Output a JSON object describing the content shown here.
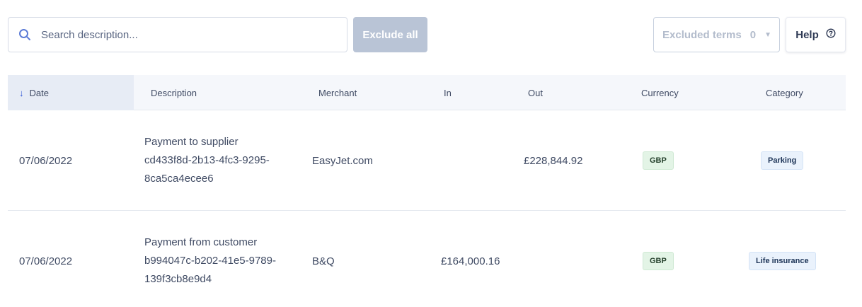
{
  "toolbar": {
    "search_placeholder": "Search description...",
    "exclude_all_label": "Exclude all",
    "excluded_terms_label": "Excluded terms",
    "excluded_terms_count": "0",
    "help_label": "Help"
  },
  "table": {
    "headers": {
      "date": "Date",
      "description": "Description",
      "merchant": "Merchant",
      "in": "In",
      "out": "Out",
      "currency": "Currency",
      "category": "Category"
    },
    "sort": {
      "column": "date",
      "direction": "descending",
      "icon": "arrow-down-icon"
    },
    "rows": [
      {
        "date": "07/06/2022",
        "description_line1": "Payment to supplier",
        "description_line2": "cd433f8d-2b13-4fc3-9295-",
        "description_line3": "8ca5ca4ecee6",
        "merchant": "EasyJet.com",
        "in": "",
        "out": "£228,844.92",
        "currency": "GBP",
        "category": "Parking"
      },
      {
        "date": "07/06/2022",
        "description_line1": "Payment from customer",
        "description_line2": "b994047c-b202-41e5-9789-",
        "description_line3": "139f3cb8e9d4",
        "merchant": "B&Q",
        "in": "£164,000.16",
        "out": "",
        "currency": "GBP",
        "category": "Life insurance"
      }
    ]
  },
  "colors": {
    "accent": "#2f56d6",
    "button_disabled": "#b9c4d6",
    "header_bg": "#f5f7fb",
    "currency_badge_bg": "#e3f4e6",
    "category_badge_bg": "#eaf2fc"
  },
  "icons": [
    "search-icon",
    "caret-down-icon",
    "help-circle-icon",
    "arrow-down-icon"
  ]
}
